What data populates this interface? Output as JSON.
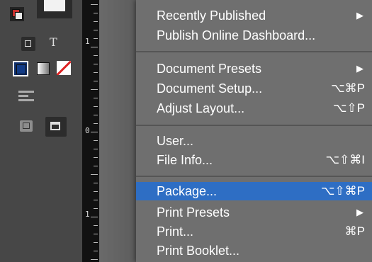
{
  "tools": {
    "type_glyph": "T"
  },
  "ruler": {
    "labels": [
      "1",
      "0",
      "1"
    ]
  },
  "menu": {
    "items": [
      {
        "label": "Recently Published",
        "shortcut": "",
        "submenu": true
      },
      {
        "label": "Publish Online Dashboard...",
        "shortcut": "",
        "submenu": false
      },
      {
        "label": "Document Presets",
        "shortcut": "",
        "submenu": true
      },
      {
        "label": "Document Setup...",
        "shortcut": "⌥⌘P",
        "submenu": false
      },
      {
        "label": "Adjust Layout...",
        "shortcut": "⌥⇧P",
        "submenu": false
      },
      {
        "label": "User...",
        "shortcut": "",
        "submenu": false
      },
      {
        "label": "File Info...",
        "shortcut": "⌥⇧⌘I",
        "submenu": false
      },
      {
        "label": "Package...",
        "shortcut": "⌥⇧⌘P",
        "submenu": false,
        "highlighted": true
      },
      {
        "label": "Print Presets",
        "shortcut": "",
        "submenu": true
      },
      {
        "label": "Print...",
        "shortcut": "⌘P",
        "submenu": false
      },
      {
        "label": "Print Booklet...",
        "shortcut": "",
        "submenu": false
      }
    ],
    "submenu_arrow": "▶",
    "highlight_color": "#2e6ec4"
  }
}
